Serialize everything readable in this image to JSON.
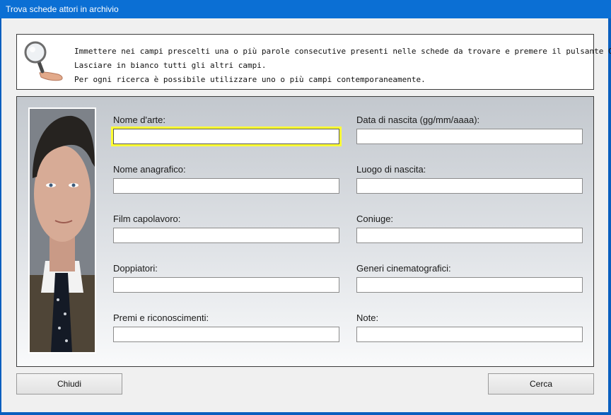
{
  "window": {
    "title": "Trova schede attori in archivio"
  },
  "info": {
    "lines": [
      "Immettere nei campi prescelti una o più parole consecutive presenti nelle schede da trovare e premere il pulsante Cerca.",
      "Lasciare in bianco tutti gli altri campi.",
      "Per ogni ricerca è possibile utilizzare uno o più campi contemporaneamente."
    ],
    "icon": "magnifier-icon"
  },
  "fields": {
    "left": [
      {
        "label": "Nome d'arte:",
        "value": ""
      },
      {
        "label": "Nome anagrafico:",
        "value": ""
      },
      {
        "label": "Film capolavoro:",
        "value": ""
      },
      {
        "label": "Doppiatori:",
        "value": ""
      },
      {
        "label": "Premi e riconoscimenti:",
        "value": ""
      }
    ],
    "right": [
      {
        "label": "Data di nascita (gg/mm/aaaa):",
        "value": ""
      },
      {
        "label": "Luogo di nascita:",
        "value": ""
      },
      {
        "label": "Coniuge:",
        "value": ""
      },
      {
        "label": "Generi cinematografici:",
        "value": ""
      },
      {
        "label": "Note:",
        "value": ""
      }
    ]
  },
  "buttons": {
    "close": "Chiudi",
    "search": "Cerca"
  },
  "colors": {
    "titlebar": "#0b6fd4",
    "focus_highlight": "#ffff33"
  }
}
